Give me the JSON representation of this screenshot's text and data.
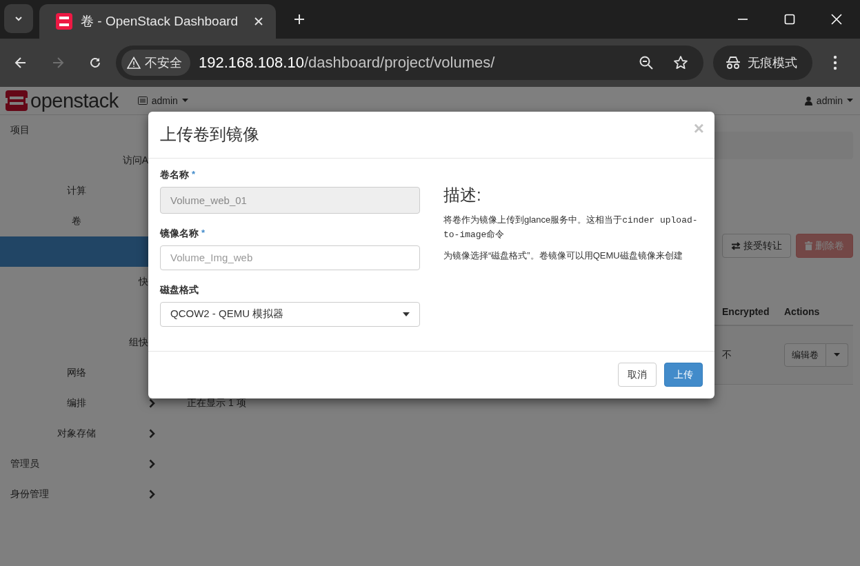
{
  "browser": {
    "tab_title": "卷 - OpenStack Dashboard",
    "security_label": "不安全",
    "url_host": "192.168.108.10",
    "url_path": "/dashboard/project/volumes/",
    "forward_disabled": true,
    "profile_label": "无痕模式"
  },
  "header": {
    "brand": "openstack",
    "project": "admin",
    "user": "admin"
  },
  "sidebar": {
    "items": [
      {
        "label": "项目",
        "selected": false,
        "children": [
          {
            "label": "访问A",
            "selected": false
          },
          {
            "label": "计算",
            "selected": false,
            "kind": "group"
          },
          {
            "label": "卷",
            "selected": false,
            "children": [
              {
                "selected": true
              },
              {
                "label": "快",
                "selected": false
              },
              {
                "selected": false
              },
              {
                "label": "组快",
                "selected": false
              }
            ]
          },
          {
            "label": "网络",
            "selected": false,
            "kind": "group"
          },
          {
            "label": "编排",
            "selected": false,
            "collapsed": true,
            "kind": "group"
          },
          {
            "label": "对象存储",
            "selected": false,
            "collapsed": true,
            "kind": "group"
          }
        ]
      },
      {
        "label": "管理员",
        "selected": false,
        "collapsed": true
      },
      {
        "label": "身份管理",
        "selected": false,
        "collapsed": true
      }
    ]
  },
  "main": {
    "buttons": [
      {
        "label": "接受转让",
        "kind": "transfer",
        "disabled": false
      },
      {
        "label": "删除卷",
        "kind": "delete",
        "disabled": true
      }
    ],
    "table": {
      "columns": [
        "Encrypted",
        "Actions"
      ],
      "rows": [
        {
          "encrypted": "不",
          "action": "编辑卷"
        }
      ]
    },
    "footer": "正在显示 1 项"
  },
  "dialog": {
    "title": "上传卷到镜像",
    "close": "×",
    "fields": [
      {
        "kind": "text",
        "label": "卷名称",
        "required_mark": "*",
        "value": "Volume_web_01",
        "disabled": true
      },
      {
        "kind": "text",
        "label": "镜像名称",
        "required_mark": "*",
        "placeholder": "Volume_Img_web",
        "disabled": false
      },
      {
        "kind": "select",
        "label": "磁盘格式",
        "value": "QCOW2 - QEMU 模拟器"
      }
    ],
    "description": {
      "heading": "描述:",
      "paragraphs": [
        [
          {
            "kind": "text",
            "text": "将卷作为镜像上传到glance服务中。这相当于"
          },
          {
            "kind": "code",
            "text": "cinder upload-to-image"
          },
          {
            "kind": "text",
            "text": "命令"
          }
        ],
        [
          {
            "kind": "text",
            "text": "为镜像选择“磁盘格式”。卷镜像可以用QEMU磁盘镜像来创建"
          }
        ]
      ]
    },
    "buttons": [
      {
        "label": "取消",
        "kind": "default"
      },
      {
        "label": "上传",
        "kind": "primary"
      }
    ]
  }
}
